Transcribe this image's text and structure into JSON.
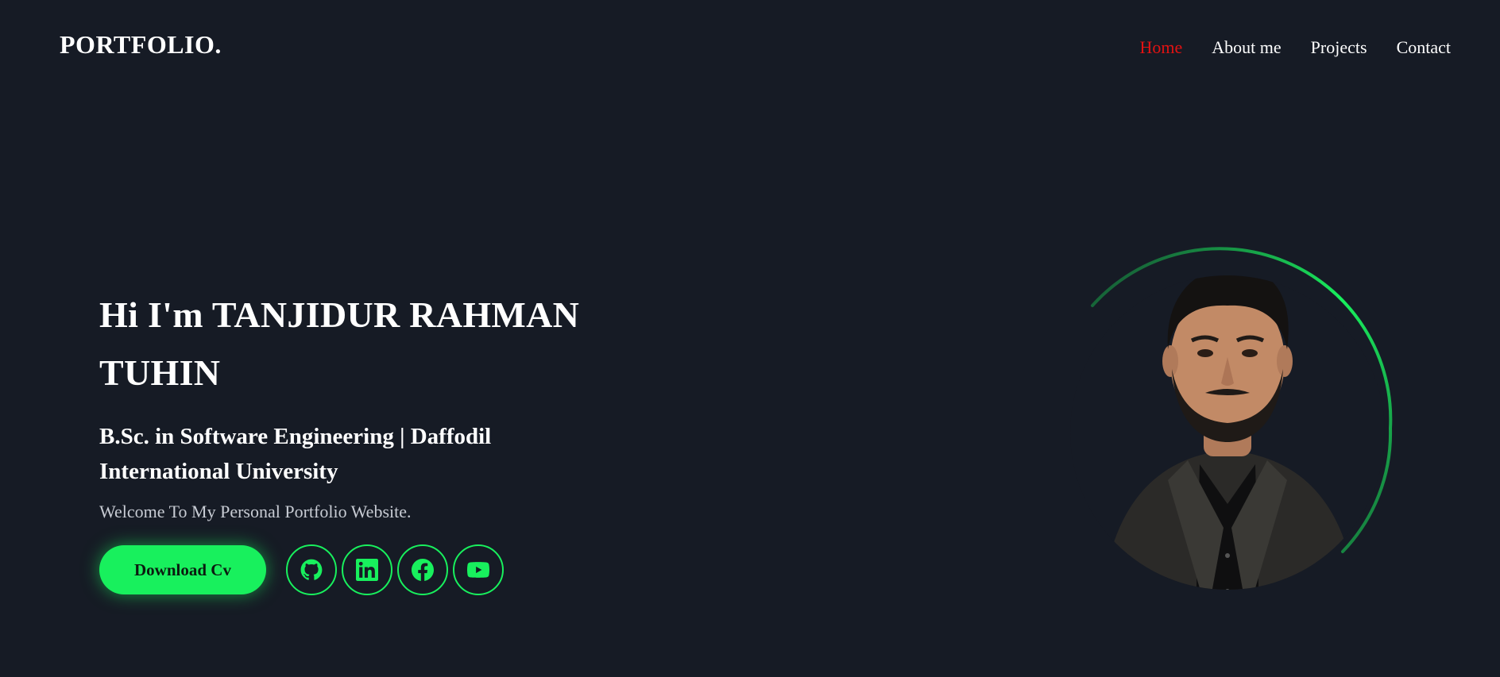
{
  "header": {
    "logo": "PORTFOLIO.",
    "nav": [
      {
        "label": "Home",
        "active": true
      },
      {
        "label": "About me",
        "active": false
      },
      {
        "label": "Projects",
        "active": false
      },
      {
        "label": "Contact",
        "active": false
      }
    ]
  },
  "hero": {
    "heading_line1": "Hi I'm TANJIDUR RAHMAN",
    "heading_line2": "TUHIN",
    "subtitle": "B.Sc. in Software Engineering | Daffodil International University",
    "welcome": "Welcome To My Personal Portfolio Website.",
    "cv_button": "Download Cv",
    "socials": [
      {
        "icon": "github-icon"
      },
      {
        "icon": "linkedin-icon"
      },
      {
        "icon": "facebook-icon"
      },
      {
        "icon": "youtube-icon"
      }
    ]
  },
  "colors": {
    "background": "#161b25",
    "accent": "#18f05d",
    "active_nav": "#e31212"
  }
}
